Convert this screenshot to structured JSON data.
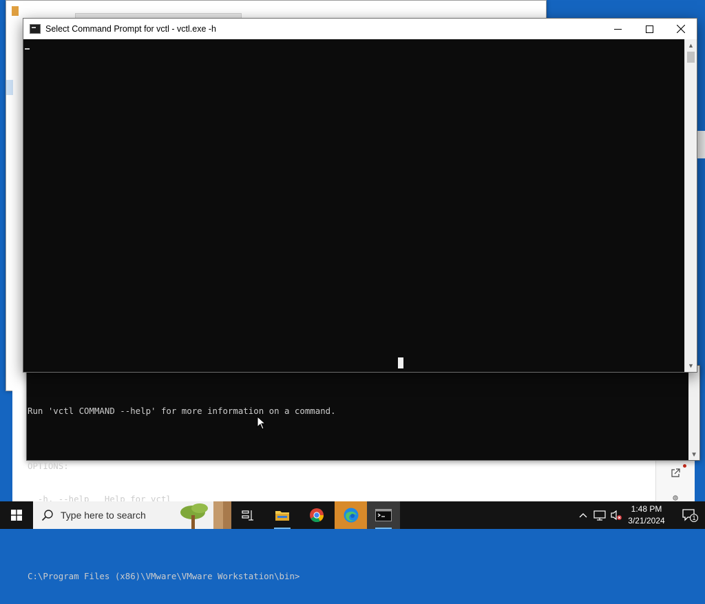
{
  "cmd_window": {
    "title": "Select Command Prompt for vctl - vctl.exe  -h",
    "icon": "cmd-icon",
    "controls": [
      "minimize-icon",
      "maximize-icon",
      "close-icon"
    ]
  },
  "console_output": {
    "lines": [
      "Run 'vctl COMMAND --help' for more information on a command.",
      "",
      "OPTIONS:",
      "  -h, --help   Help for vctl",
      "",
      "",
      "C:\\Program Files (x86)\\VMware\\VMware Workstation\\bin>"
    ]
  },
  "taskbar": {
    "search_placeholder": "Type here to search",
    "apps": [
      "task-view-icon",
      "file-explorer-icon",
      "chrome-icon",
      "edge-icon",
      "command-prompt-icon"
    ],
    "time": "1:48 PM",
    "date": "3/21/2024",
    "notification_count": "1"
  },
  "colors": {
    "console_bg": "#0c0c0c",
    "console_text": "#cccccc",
    "desktop": "#1565c0",
    "taskbar": "#141414"
  }
}
